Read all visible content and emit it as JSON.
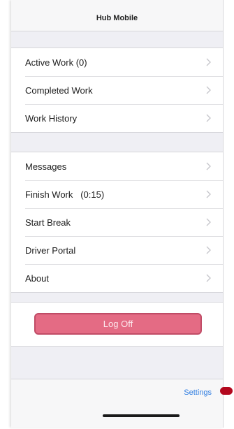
{
  "app": {
    "title": "Hub Mobile"
  },
  "menu_group_1": {
    "items": [
      {
        "label": "Active Work (0)",
        "icon": "chevron-right-icon"
      },
      {
        "label": "Completed Work",
        "icon": "chevron-right-icon"
      },
      {
        "label": "Work History",
        "icon": "chevron-right-icon"
      }
    ]
  },
  "menu_group_2": {
    "items": [
      {
        "label": "Messages",
        "icon": "chevron-right-icon"
      },
      {
        "label": "Finish Work   (0:15)",
        "icon": "chevron-right-icon"
      },
      {
        "label": "Start Break",
        "icon": "chevron-right-icon"
      },
      {
        "label": "Driver Portal",
        "icon": "chevron-right-icon"
      },
      {
        "label": "About",
        "icon": "chevron-right-icon"
      }
    ]
  },
  "logoff": {
    "label": "Log Off"
  },
  "footer": {
    "settings_label": "Settings"
  },
  "colors": {
    "logoff_fill": "#e46b84",
    "logoff_border": "#c04c66",
    "link": "#2f7de1",
    "marker": "#b3081e"
  }
}
